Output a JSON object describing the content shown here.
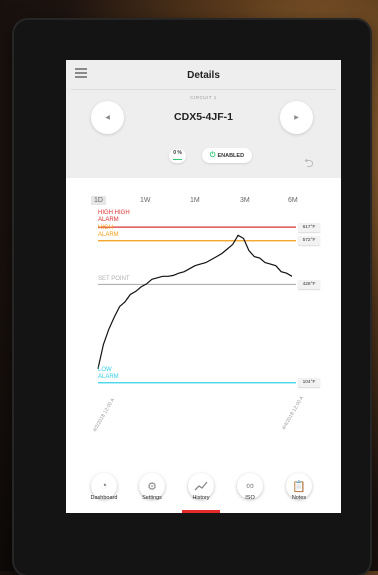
{
  "header": {
    "title": "Details"
  },
  "circuit": {
    "label": "CIRCUIT 1",
    "name": "CDX5-4JF-1"
  },
  "status": {
    "percent": "0 %",
    "enabled": "ENABLED"
  },
  "icons": {
    "menu": "menu-icon",
    "prev": "chevron-left-icon",
    "next": "chevron-right-icon",
    "power": "power-icon",
    "back": "back-arrow-icon"
  },
  "tabs": [
    "1D",
    "1W",
    "1M",
    "3M",
    "6M"
  ],
  "alarms": {
    "high_high": {
      "label_line1": "HIGH HIGH",
      "label_line2": "ALARM",
      "value": "617°F",
      "color": "#d93232"
    },
    "high": {
      "label_line1": "HIGH",
      "label_line2": "ALARM",
      "value": "572°F",
      "color": "#f39c12"
    },
    "set_point": {
      "label": "SET POINT",
      "value": "428°F",
      "color": "#b0b0b0"
    },
    "low": {
      "label_line1": "LOW",
      "label_line2": "ALARM",
      "value": "104°F",
      "color": "#33d1e6"
    }
  },
  "x_dates": {
    "start": "4/2/2018 12:00 A",
    "end": "4/4/2018 12:00 A"
  },
  "chart_data": {
    "type": "line",
    "series": [
      {
        "values": [
          150,
          230,
          280,
          320,
          355,
          370,
          395,
          405,
          420,
          430,
          445,
          450,
          455,
          455,
          458,
          465,
          470,
          480,
          490,
          495,
          500,
          510,
          520,
          530,
          545,
          560,
          590,
          580,
          540,
          520,
          515,
          500,
          495,
          490,
          470,
          465,
          455
        ]
      }
    ],
    "thresholds": [
      617,
      572,
      428,
      104
    ],
    "ylim": [
      80,
      690
    ]
  },
  "dock": [
    {
      "label": "Dashboard",
      "icon": "gauge-icon"
    },
    {
      "label": "Settings",
      "icon": "gear-icon"
    },
    {
      "label": "History",
      "icon": "chart-line-icon"
    },
    {
      "label": "ISO",
      "icon": "infinity-icon"
    },
    {
      "label": "Notes",
      "icon": "clipboard-icon"
    }
  ],
  "colors": {
    "accent": "#e32b2b",
    "enabled": "#2ecc71"
  }
}
